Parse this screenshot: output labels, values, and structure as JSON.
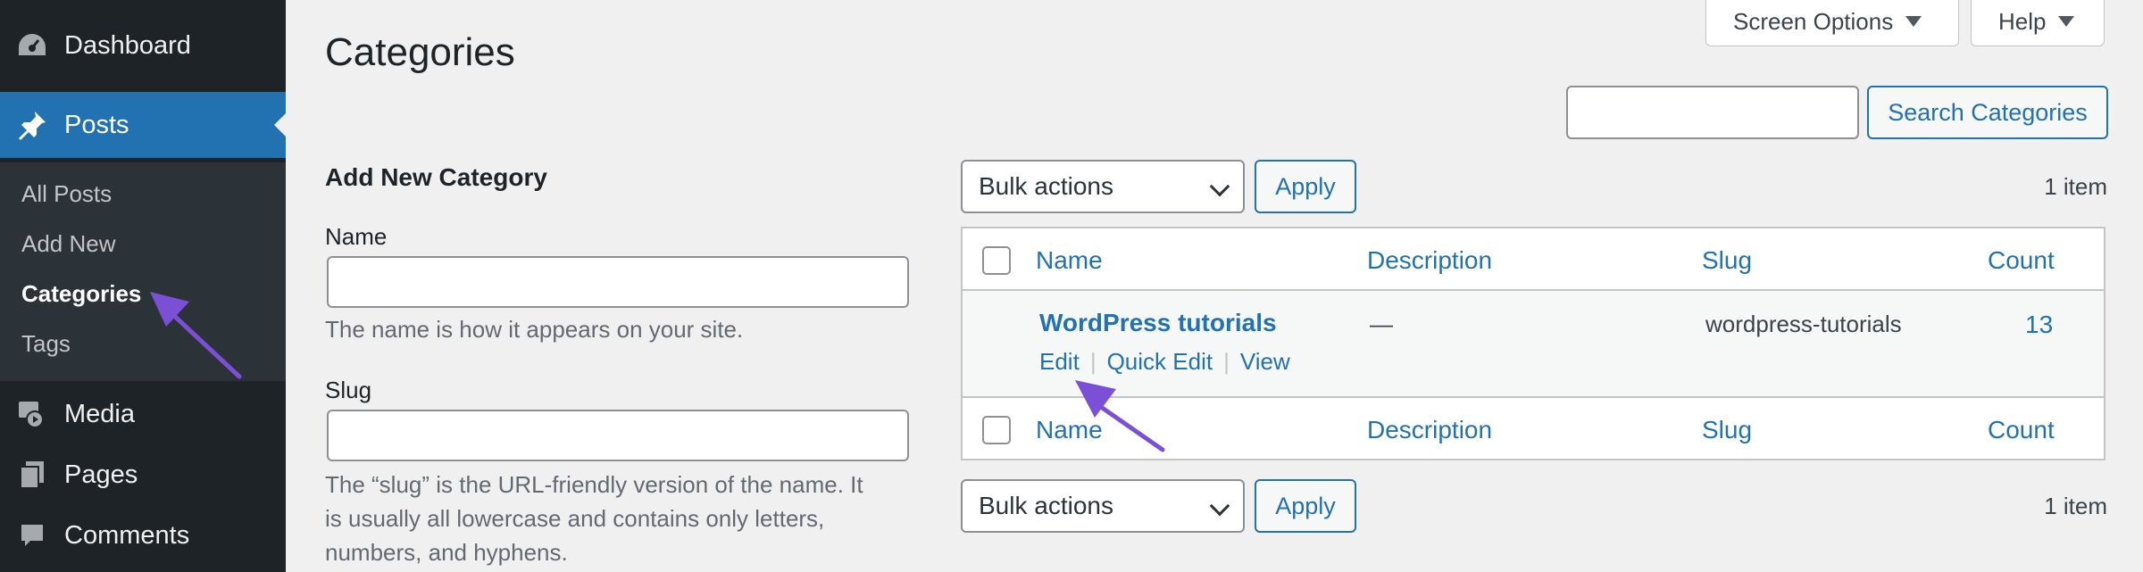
{
  "sidebar": {
    "dashboard": "Dashboard",
    "posts": "Posts",
    "sub_items": [
      "All Posts",
      "Add New",
      "Categories",
      "Tags"
    ],
    "media": "Media",
    "pages": "Pages",
    "comments": "Comments"
  },
  "header": {
    "title": "Categories",
    "screen_options": "Screen Options",
    "help": "Help"
  },
  "form": {
    "title": "Add New Category",
    "name_label": "Name",
    "name_value": "",
    "name_help": "The name is how it appears on your site.",
    "slug_label": "Slug",
    "slug_value": "",
    "slug_help_lines": [
      "The “slug” is the URL-friendly version of the name. It",
      "is usually all lowercase and contains only letters,",
      "numbers, and hyphens."
    ]
  },
  "search": {
    "value": "",
    "button": "Search Categories"
  },
  "tablenav": {
    "bulk_actions": "Bulk actions",
    "apply": "Apply",
    "items_count": "1 item"
  },
  "table": {
    "columns": [
      "Name",
      "Description",
      "Slug",
      "Count"
    ],
    "rows": [
      {
        "name": "WordPress tutorials",
        "description": "—",
        "slug": "wordpress-tutorials",
        "count": "13",
        "actions": [
          "Edit",
          "Quick Edit",
          "View"
        ]
      }
    ]
  },
  "colors": {
    "sidebar_bg": "#1d2327",
    "active_menu": "#2271b1",
    "link": "#2271b1",
    "annotation_arrow": "#7b4fd6"
  }
}
